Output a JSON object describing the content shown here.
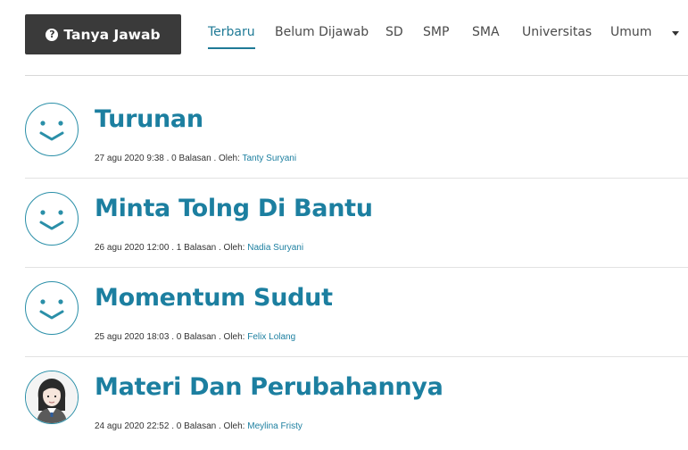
{
  "header": {
    "ask_button_label": "Tanya Jawab",
    "ask_icon_glyph": "?",
    "tabs": [
      {
        "label": "Terbaru",
        "active": true
      },
      {
        "label": "Belum Dijawab",
        "active": false
      },
      {
        "label": "SD",
        "active": false
      },
      {
        "label": "SMP",
        "active": false
      },
      {
        "label": "SMA",
        "active": false
      },
      {
        "label": "Universitas",
        "active": false
      },
      {
        "label": "Umum",
        "active": false
      }
    ],
    "more_icon": "caret-down-icon"
  },
  "questions": [
    {
      "title": "Turunan",
      "meta": "27 agu 2020 9:38 . 0 Balasan . Oleh: ",
      "author": "Tanty Suryani",
      "avatar": "smiley-icon"
    },
    {
      "title": "Minta Tolng Di Bantu",
      "meta": "26 agu 2020 12:00 . 1 Balasan . Oleh: ",
      "author": "Nadia Suryani",
      "avatar": "smiley-icon"
    },
    {
      "title": "Momentum Sudut",
      "meta": "25 agu 2020 18:03 . 0 Balasan . Oleh: ",
      "author": "Felix Lolang",
      "avatar": "smiley-icon"
    },
    {
      "title": "Materi Dan Perubahannya",
      "meta": "24 agu 2020 22:52 . 0 Balasan . Oleh: ",
      "author": "Meylina Fristy",
      "avatar": "user-photo"
    }
  ],
  "colors": {
    "accent": "#1c7fa0",
    "button_bg": "#3a3a3a",
    "divider": "#e2e2e2"
  }
}
